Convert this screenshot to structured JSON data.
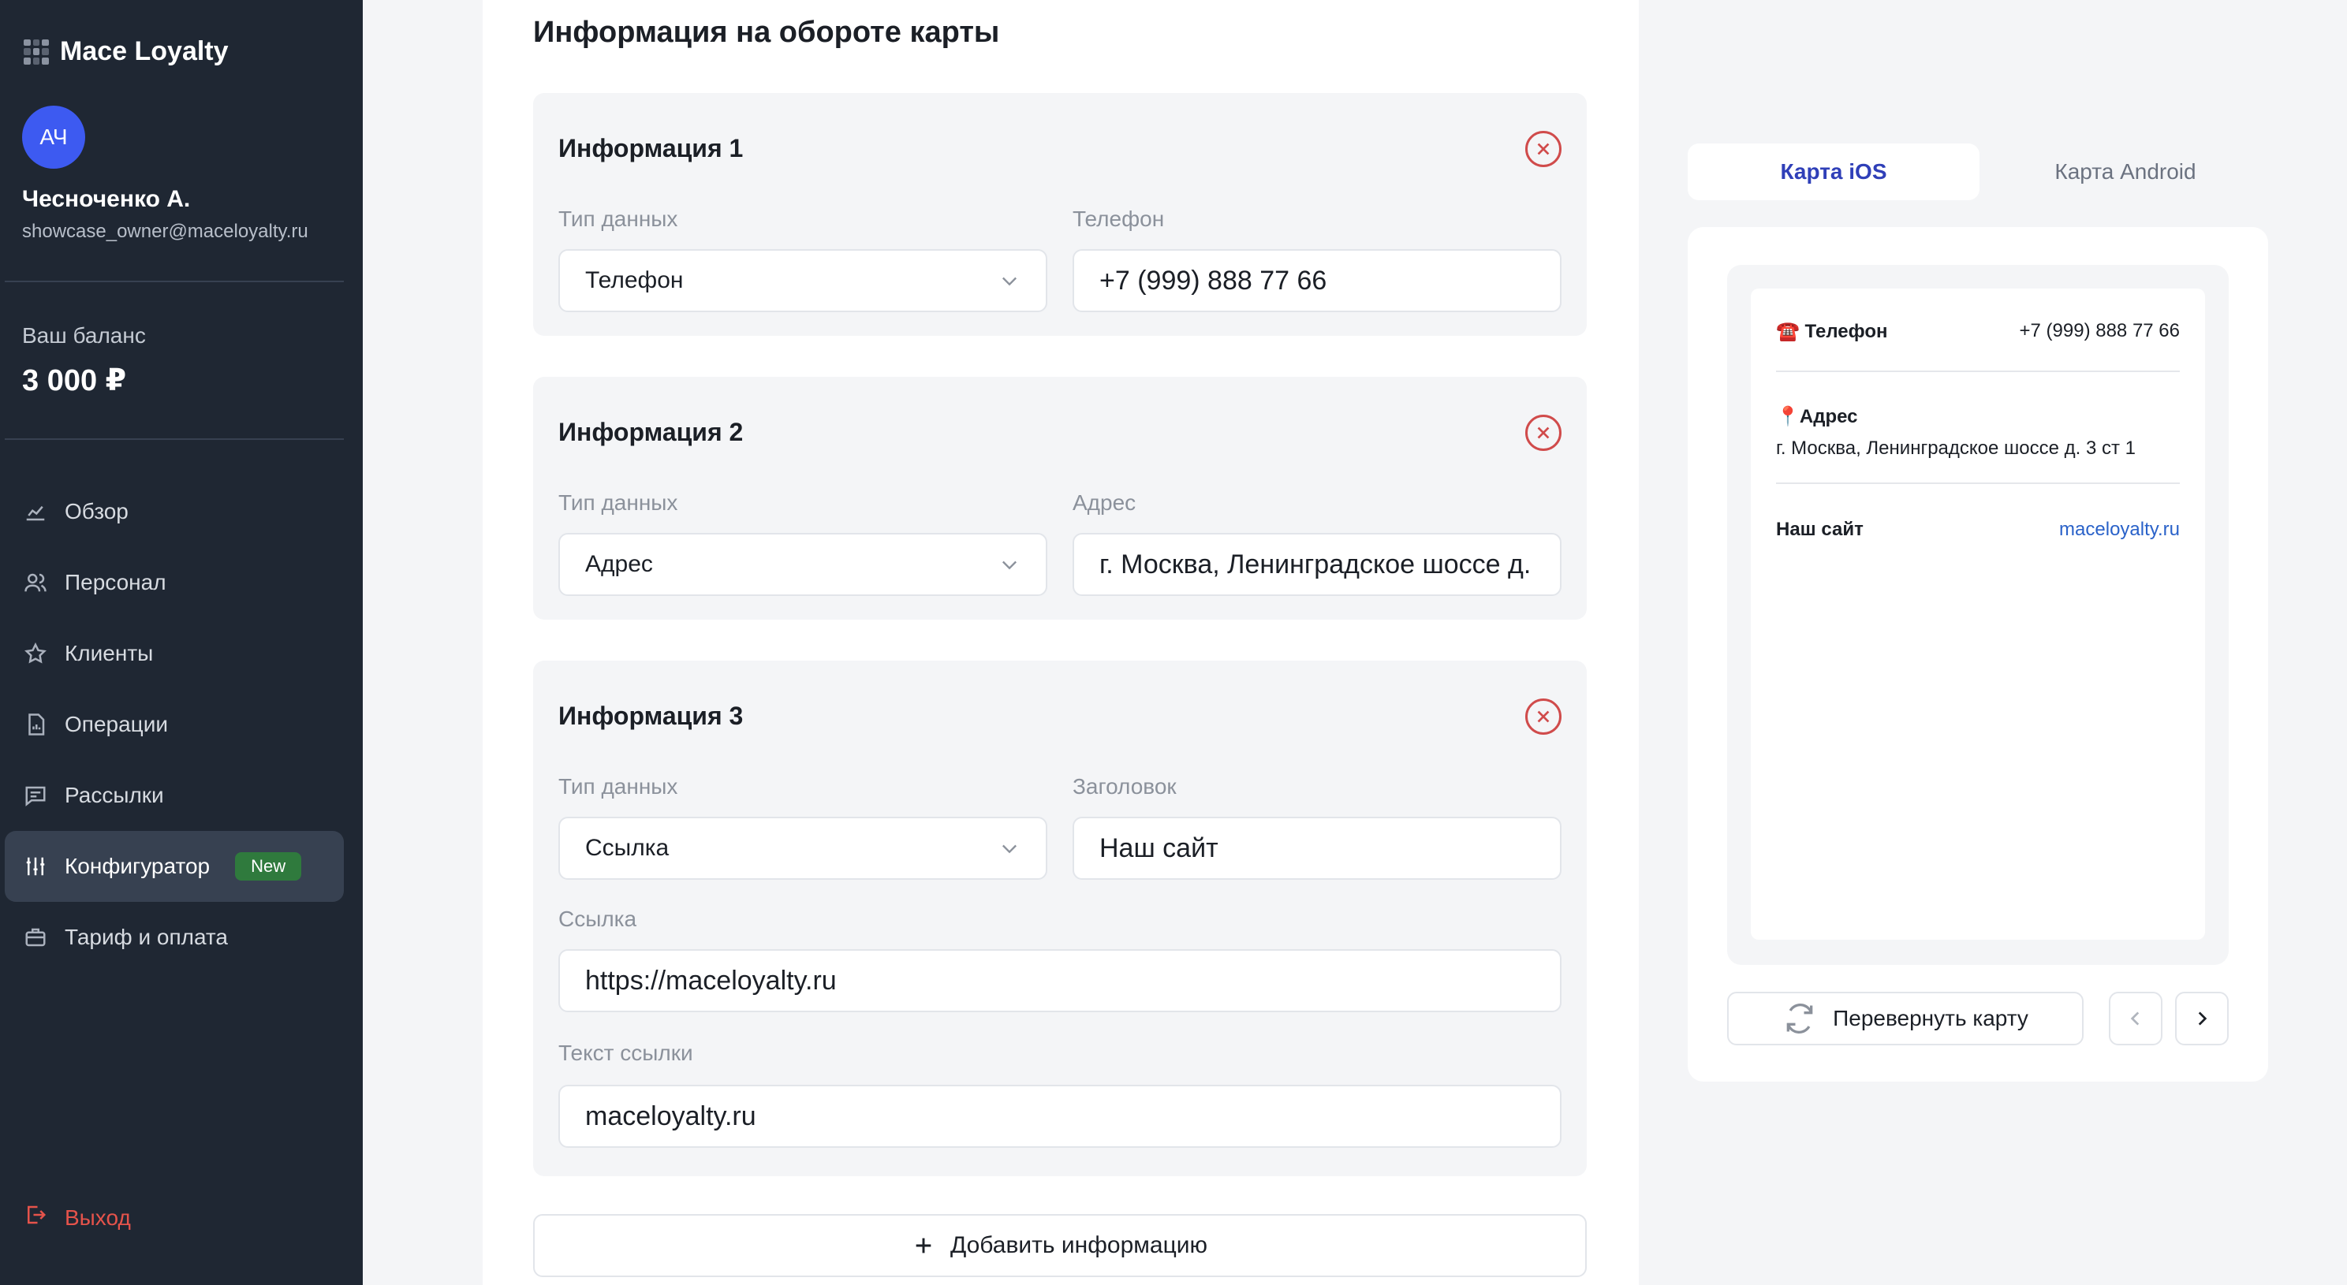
{
  "sidebar": {
    "brand": "Mace Loyalty",
    "avatar_initials": "АЧ",
    "user_name": "Чесноченко А.",
    "user_email": "showcase_owner@maceloyalty.ru",
    "balance_label": "Ваш баланс",
    "balance_value": "3 000 ₽",
    "nav": [
      {
        "label": "Обзор",
        "icon": "chart-icon"
      },
      {
        "label": "Персонал",
        "icon": "users-icon"
      },
      {
        "label": "Клиенты",
        "icon": "star-icon"
      },
      {
        "label": "Операции",
        "icon": "document-icon"
      },
      {
        "label": "Рассылки",
        "icon": "message-icon"
      },
      {
        "label": "Конфигуратор",
        "icon": "sliders-icon",
        "badge": "New",
        "active": true
      },
      {
        "label": "Тариф и оплата",
        "icon": "briefcase-icon"
      }
    ],
    "logout": "Выход"
  },
  "editor": {
    "title": "Информация на обороте карты",
    "blocks": [
      {
        "title": "Информация 1",
        "type_label": "Тип данных",
        "type_value": "Телефон",
        "value_label": "Телефон",
        "value": "+7 (999) 888 77 66"
      },
      {
        "title": "Информация 2",
        "type_label": "Тип данных",
        "type_value": "Адрес",
        "value_label": "Адрес",
        "value": "г. Москва, Ленинградское шоссе д. 3 ст 1"
      },
      {
        "title": "Информация 3",
        "type_label": "Тип данных",
        "type_value": "Ссылка",
        "value_label": "Заголовок",
        "value": "Наш сайт",
        "link_label": "Ссылка",
        "link_value": "https://maceloyalty.ru",
        "link_text_label": "Текст ссылки",
        "link_text_value": "maceloyalty.ru"
      }
    ],
    "add_button": "Добавить информацию"
  },
  "preview": {
    "tabs": [
      "Карта iOS",
      "Карта Android"
    ],
    "active_tab": 0,
    "phone_key": "☎️ Телефон",
    "phone_value": "+7 (999) 888 77 66",
    "address_key": "📍Адрес",
    "address_value": "г. Москва, Ленинградское шоссе д. 3 ст 1",
    "site_key": "Наш сайт",
    "site_value": "maceloyalty.ru",
    "flip_button": "Перевернуть карту"
  },
  "colors": {
    "sidebar_bg": "#1f2733",
    "accent": "#2f3fb8",
    "danger": "#d04b4b",
    "badge": "#2f7a3d",
    "link": "#2a62c9"
  }
}
